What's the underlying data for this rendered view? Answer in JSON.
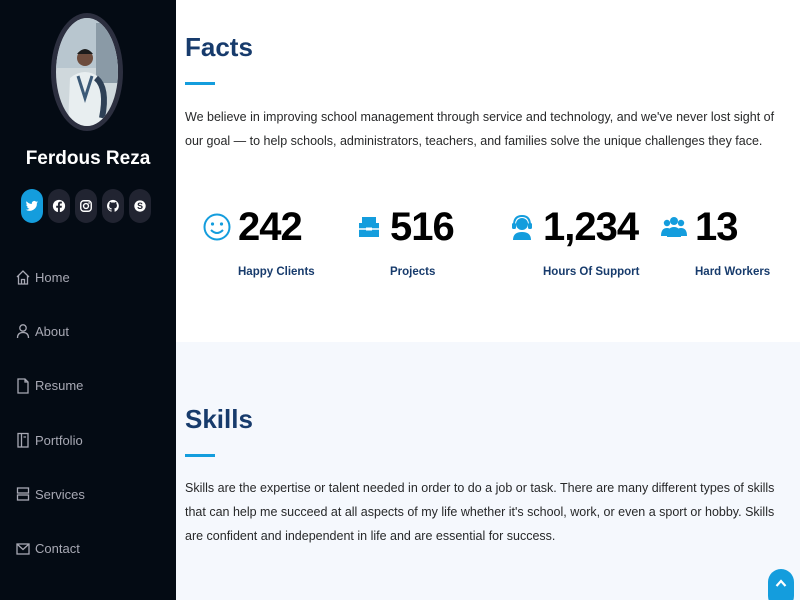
{
  "profile": {
    "name": "Ferdous Reza"
  },
  "social": [
    {
      "icon": "twitter-icon",
      "active": true
    },
    {
      "icon": "facebook-icon",
      "active": false
    },
    {
      "icon": "instagram-icon",
      "active": false
    },
    {
      "icon": "github-icon",
      "active": false
    },
    {
      "icon": "skype-icon",
      "active": false
    }
  ],
  "nav": {
    "items": [
      {
        "label": "Home",
        "icon": "home-icon"
      },
      {
        "label": "About",
        "icon": "person-icon"
      },
      {
        "label": "Resume",
        "icon": "file-icon"
      },
      {
        "label": "Portfolio",
        "icon": "book-icon"
      },
      {
        "label": "Services",
        "icon": "server-icon"
      },
      {
        "label": "Contact",
        "icon": "envelope-icon"
      }
    ]
  },
  "facts": {
    "title": "Facts",
    "text": "We believe in improving school management through service and technology, and we've never lost sight of our goal — to help schools, administrators, teachers, and families solve the unique challenges they face.",
    "items": [
      {
        "number": "242",
        "label": "Happy Clients",
        "icon": "smile-icon"
      },
      {
        "number": "516",
        "label": "Projects",
        "icon": "journal-icon"
      },
      {
        "number": "1,234",
        "label": "Hours Of Support",
        "icon": "headset-icon"
      },
      {
        "number": "13",
        "label": "Hard Workers",
        "icon": "people-icon"
      }
    ]
  },
  "skills": {
    "title": "Skills",
    "text": "Skills are the expertise or talent needed in order to do a job or task. There are many different types of skills that can help me succeed at all aspects of my life whether it's school, work, or even a sport or hobby. Skills are confident and independent in life and are essential for success."
  },
  "colors": {
    "sidebar_bg": "#040b14",
    "accent": "#149ddd",
    "heading": "#173b6c",
    "skills_bg": "#f5f8fd"
  }
}
